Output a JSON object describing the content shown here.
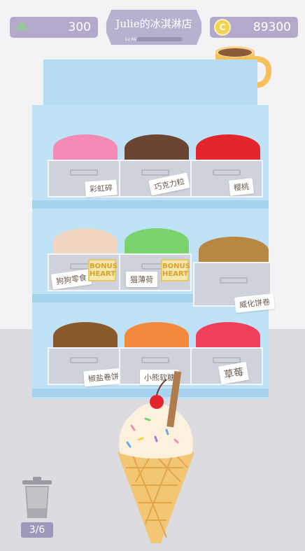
{
  "hud": {
    "clover_icon": "clover-icon",
    "clover_count": "300",
    "coin_symbol": "C",
    "coin_count": "89300",
    "title": "Julie的冰淇淋店",
    "level_label": "Lv MAX"
  },
  "colors": {
    "hud_pill": "#b3aacb",
    "cabinet": "#bfe2f6",
    "bin": "#cfd2da",
    "floor": "#dcdbdf"
  },
  "toppings": [
    {
      "name": "彩虹碎",
      "color": "#f48ab6"
    },
    {
      "name": "巧克力粒",
      "color": "#6b4433"
    },
    {
      "name": "樱桃",
      "color": "#e2262c"
    },
    {
      "name": "狗狗零食",
      "color": "#f1d7c1",
      "tag": "BONUS HEART"
    },
    {
      "name": "猫薄荷",
      "color": "#7ad36d",
      "tag": "BONUS HEART"
    },
    {
      "name": "威化饼卷",
      "color": "#b88742"
    },
    {
      "name": "椒盐卷饼",
      "color": "#8b5a2b"
    },
    {
      "name": "小熊软糖",
      "color": "#f2893c"
    },
    {
      "name": "草莓",
      "color": "#ef3f5b"
    }
  ],
  "tag_text": {
    "line1": "BONUS",
    "line2": "HEART"
  },
  "trash": {
    "count": "3/6"
  }
}
